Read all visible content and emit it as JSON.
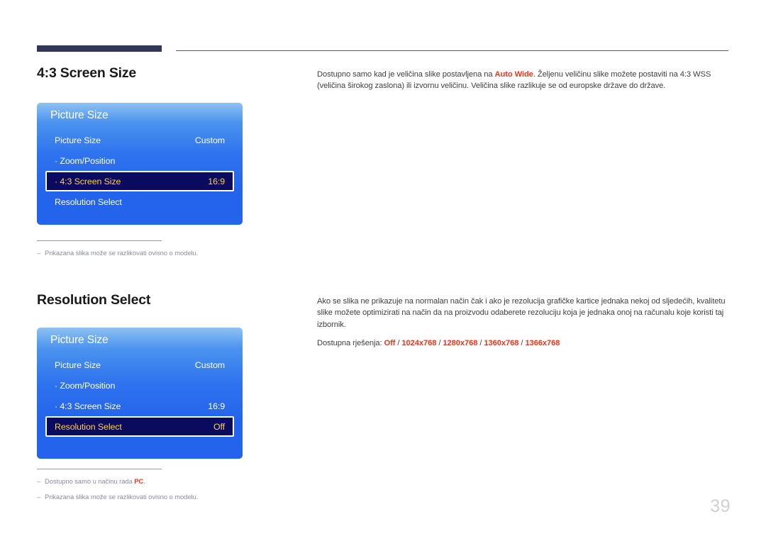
{
  "page": {
    "number": "39"
  },
  "sections": [
    {
      "title": "4:3 Screen Size",
      "body_html": "Dostupno samo kad je veličina slike postavljena na <b class=\"hl\">Auto Wide</b>. Željenu veličinu slike možete postaviti na 4:3 WSS (veličina širokog zaslona) ili izvornu veličinu. Veličina slike razlikuje se od europske države do države.",
      "osd": {
        "title": "Picture Size",
        "rows": [
          {
            "label": "Picture Size",
            "value": "Custom",
            "selected": false
          },
          {
            "label": "· Zoom/Position",
            "value": "",
            "selected": false
          },
          {
            "label": "· 4:3 Screen Size",
            "value": "16:9",
            "selected": true
          },
          {
            "label": "Resolution Select",
            "value": "",
            "selected": false
          }
        ]
      },
      "notes": [
        {
          "text": "Prikazana slika može se razlikovati ovisno o modelu.",
          "html": "Prikazana slika može se razlikovati ovisno o modelu."
        }
      ]
    },
    {
      "title": "Resolution Select",
      "body_html": "Ako se slika ne prikazuje na normalan način čak i ako je rezolucija grafičke kartice jednaka nekoj od sljedećih, kvalitetu slike možete optimizirati na način da na proizvodu odaberete rezoluciju koja je jednaka onoj na računalu koje koristi taj izbornik.",
      "body_html_2": "Dostupna rješenja: <b class=\"hl\">Off</b> / <b class=\"hl\">1024x768</b> / <b class=\"hl\">1280x768</b> / <b class=\"hl\">1360x768</b> / <b class=\"hl\">1366x768</b>",
      "options": [
        "Off",
        "1024x768",
        "1280x768",
        "1360x768",
        "1366x768"
      ],
      "osd": {
        "title": "Picture Size",
        "rows": [
          {
            "label": "Picture Size",
            "value": "Custom",
            "selected": false
          },
          {
            "label": "· Zoom/Position",
            "value": "",
            "selected": false
          },
          {
            "label": "· 4:3 Screen Size",
            "value": "16:9",
            "selected": false
          },
          {
            "label": "Resolution Select",
            "value": "Off",
            "selected": true
          }
        ]
      },
      "notes": [
        {
          "text": "Dostupno samo u načinu rada PC.",
          "html": "Dostupno samo u načinu rada <b class=\"redb\">PC</b>."
        },
        {
          "text": "Prikazana slika može se razlikovati ovisno o modelu.",
          "html": "Prikazana slika može se razlikovati ovisno o modelu."
        }
      ]
    }
  ],
  "colors": {
    "accent_red": "#e8381c",
    "osd_blue_top": "#8ec2f2",
    "osd_blue_bottom": "#2463eb",
    "osd_selected_bg": "#0a0a5e",
    "osd_selected_text": "#ffd24a",
    "rule_navy": "#333757"
  }
}
